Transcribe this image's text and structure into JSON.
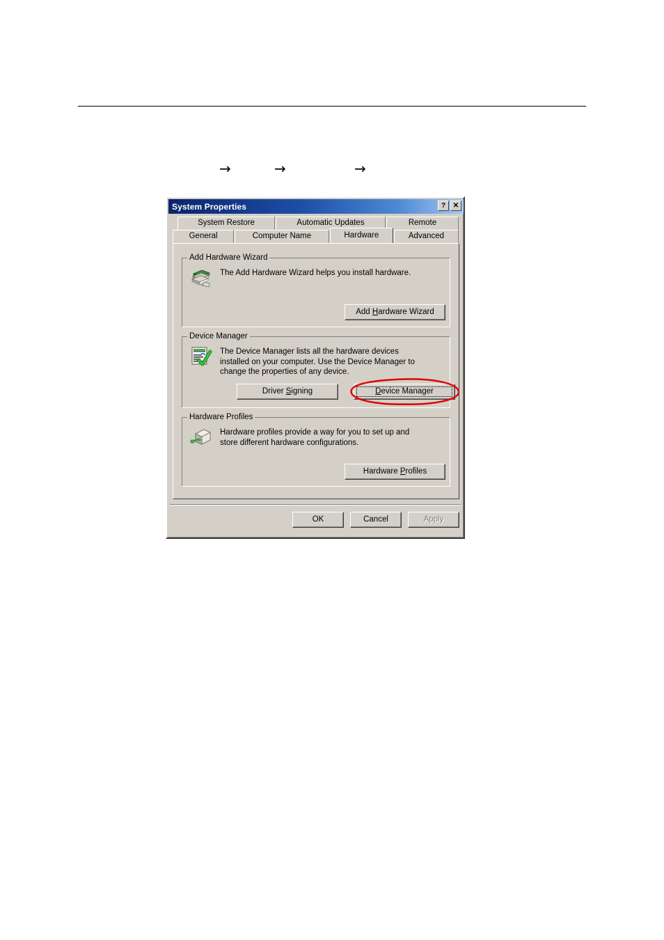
{
  "page": {
    "arrows": [
      "→",
      "→",
      "→"
    ]
  },
  "dialog": {
    "title": "System Properties",
    "titlebar_buttons": [
      {
        "name": "help-button",
        "label": "?"
      },
      {
        "name": "close-button",
        "label": "✕"
      }
    ],
    "tabs_row1": [
      {
        "label": "System Restore",
        "selected": false
      },
      {
        "label": "Automatic Updates",
        "selected": false
      },
      {
        "label": "Remote",
        "selected": false
      }
    ],
    "tabs_row2": [
      {
        "label": "General",
        "selected": false
      },
      {
        "label": "Computer Name",
        "selected": false
      },
      {
        "label": "Hardware",
        "selected": true
      },
      {
        "label": "Advanced",
        "selected": false
      }
    ],
    "groups": {
      "add_hardware_wizard": {
        "legend": "Add Hardware Wizard",
        "description": "The Add Hardware Wizard helps you install hardware.",
        "icon": "add-hardware-wizard-icon",
        "button": {
          "label_before": "Add ",
          "label_accel": "H",
          "label_after": "ardware Wizard"
        }
      },
      "device_manager": {
        "legend": "Device Manager",
        "description": "The Device Manager lists all the hardware devices installed on your computer. Use the Device Manager to change the properties of any device.",
        "icon": "device-manager-icon",
        "button_driver_signing": {
          "label_before": "Driver ",
          "label_accel": "S",
          "label_after": "igning"
        },
        "button_device_manager": {
          "label_before": "",
          "label_accel": "D",
          "label_after": "evice Manager"
        }
      },
      "hardware_profiles": {
        "legend": "Hardware Profiles",
        "description": "Hardware profiles provide a way for you to set up and store different hardware configurations.",
        "icon": "hardware-profiles-icon",
        "button": {
          "label_before": "Hardware ",
          "label_accel": "P",
          "label_after": "rofiles"
        }
      }
    },
    "bottom_buttons": {
      "ok": "OK",
      "cancel": "Cancel",
      "apply": "Apply"
    }
  },
  "annotation": {
    "type": "red-ellipse-highlight",
    "target": "device-manager-button",
    "color": "#e00000"
  }
}
